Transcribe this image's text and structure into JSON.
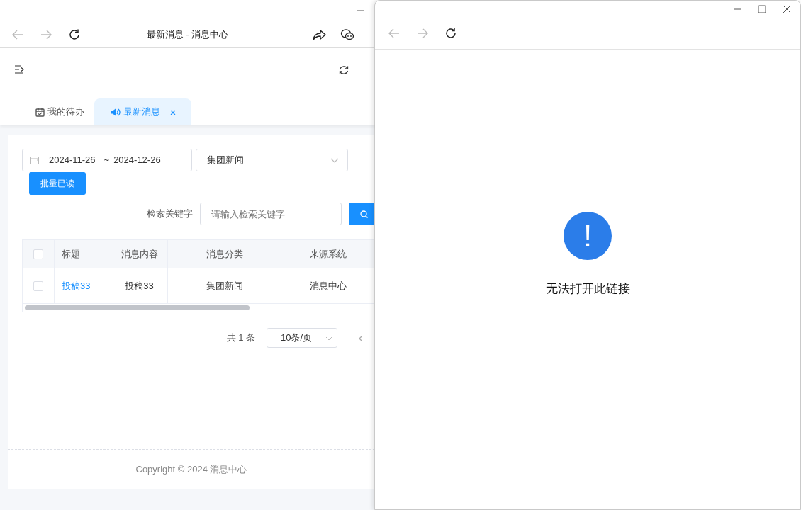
{
  "left_window": {
    "title": "最新消息 - 消息中心",
    "tabs": [
      {
        "label": "我的待办",
        "selected": false,
        "closable": false
      },
      {
        "label": "最新消息",
        "selected": true,
        "closable": true
      }
    ],
    "filters": {
      "date_start": "2024-11-26",
      "date_separator": "~",
      "date_end": "2024-12-26",
      "category": "集团新闻"
    },
    "batch_read_button": "批量已读",
    "search": {
      "label": "检索关键字",
      "placeholder": "请输入检索关键字"
    },
    "table": {
      "all_checked": false,
      "columns": [
        "标题",
        "消息内容",
        "消息分类",
        "来源系统"
      ],
      "rows": [
        {
          "checked": false,
          "cells": [
            "投稿33",
            "投稿33",
            "集团新闻",
            "消息中心"
          ]
        }
      ]
    },
    "pagination": {
      "total": "共 1 条",
      "page_size": "10条/页"
    },
    "footer": "Copyright © 2024 消息中心"
  },
  "right_window": {
    "alert_mark": "!",
    "message": "无法打开此链接"
  }
}
